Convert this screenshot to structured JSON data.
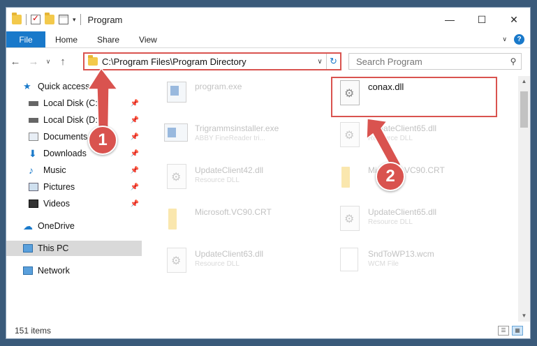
{
  "window": {
    "title": "Program",
    "minimize": "—",
    "maximize": "☐",
    "close": "✕"
  },
  "ribbon": {
    "file": "File",
    "home": "Home",
    "share": "Share",
    "view": "View",
    "expand": "∨",
    "help": "?"
  },
  "nav": {
    "back": "←",
    "forward": "→",
    "recent": "∨",
    "up": "↑",
    "address": "C:\\Program Files\\Program Directory",
    "address_dropdown": "∨",
    "refresh": "↻",
    "search_placeholder": "Search Program",
    "search_icon": "magnifier-icon"
  },
  "sidebar": {
    "items": [
      {
        "label": "Quick access",
        "icon": "star-icon",
        "color": "#1979ca"
      },
      {
        "label": "Local Disk (C:)",
        "icon": "drive-icon",
        "pinned": true
      },
      {
        "label": "Local Disk (D:)",
        "icon": "drive-icon",
        "pinned": true
      },
      {
        "label": "Documents",
        "icon": "documents-icon",
        "pinned": true
      },
      {
        "label": "Downloads",
        "icon": "download-icon",
        "pinned": true
      },
      {
        "label": "Music",
        "icon": "music-icon",
        "pinned": true
      },
      {
        "label": "Pictures",
        "icon": "pictures-icon",
        "pinned": true
      },
      {
        "label": "Videos",
        "icon": "videos-icon",
        "pinned": true
      },
      {
        "label": "OneDrive",
        "icon": "cloud-icon"
      },
      {
        "label": "This PC",
        "icon": "computer-icon",
        "selected": true
      },
      {
        "label": "Network",
        "icon": "network-icon"
      }
    ]
  },
  "files": [
    {
      "name": "program.exe",
      "sub": "",
      "type": "exe"
    },
    {
      "name": "conax.dll",
      "sub": "",
      "type": "dll",
      "highlighted": true
    },
    {
      "name": "Trigrammsinstaller.exe",
      "sub": "ABBY FineReader tri...",
      "type": "exe"
    },
    {
      "name": "UpdateClient65.dll",
      "sub": "Resource DLL",
      "type": "dll"
    },
    {
      "name": "UpdateClient42.dll",
      "sub": "Resource DLL",
      "type": "dll"
    },
    {
      "name": "Microsoft.VC90.CRT",
      "sub": "",
      "type": "folder"
    },
    {
      "name": "Microsoft.VC90.CRT",
      "sub": "",
      "type": "folder"
    },
    {
      "name": "UpdateClient65.dll",
      "sub": "Resource DLL",
      "type": "dll"
    },
    {
      "name": "UpdateClient63.dll",
      "sub": "Resource DLL",
      "type": "dll"
    },
    {
      "name": "SndToWP13.wcm",
      "sub": "WCM File",
      "type": "wcm"
    }
  ],
  "status": {
    "count": "151 items"
  },
  "annotations": {
    "step1": "1",
    "step2": "2",
    "color": "#d9534f"
  }
}
